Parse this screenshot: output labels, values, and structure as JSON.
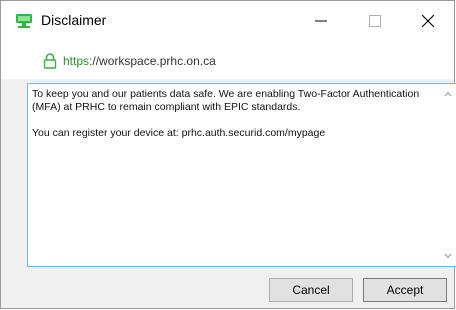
{
  "window": {
    "title": "Disclaimer",
    "icon": "monitor-icon",
    "controls": [
      "minimize-icon",
      "maximize-icon",
      "close-icon"
    ]
  },
  "urlbar": {
    "scheme": "https:",
    "host": "//workspace.prhc.on.ca",
    "lock_icon": "lock-icon",
    "secure_color": "#2e8b2e"
  },
  "message": {
    "text": "To keep you and our patients data safe. We are enabling Two-Factor Authentication (MFA) at PRHC to remain compliant with EPIC standards.\n\nYou can register your device at: prhc.auth.securid.com/mypage"
  },
  "buttons": {
    "cancel_label": "Cancel",
    "accept_label": "Accept"
  },
  "colors": {
    "focus_border": "#7fb4e6",
    "icon_green": "#3cb043"
  }
}
